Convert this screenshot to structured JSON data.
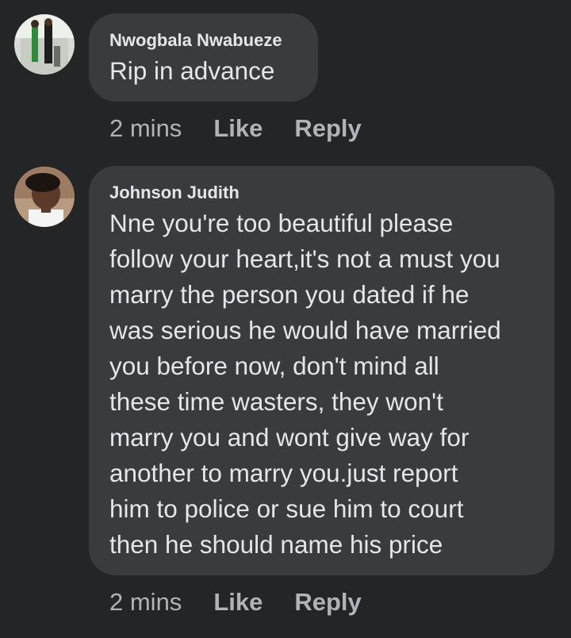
{
  "comments": [
    {
      "author": "Nwogbala Nwabueze",
      "text": "Rip in advance",
      "time": "2 mins",
      "like_label": "Like",
      "reply_label": "Reply"
    },
    {
      "author": "Johnson Judith",
      "text": "Nne you're too beautiful please\nfollow your heart,it's not a must you\nmarry the person you dated if he\nwas serious he would have married\nyou before now, don't mind all\nthese time wasters, they won't\nmarry you and wont give way for\nanother to marry you.just report\nhim to police or sue him to court\nthen he should name his price",
      "time": "2 mins",
      "like_label": "Like",
      "reply_label": "Reply"
    }
  ],
  "colors": {
    "background": "#242526",
    "bubble": "#3a3b3c",
    "text_primary": "#e4e6eb",
    "text_secondary": "#b0b3b8"
  }
}
